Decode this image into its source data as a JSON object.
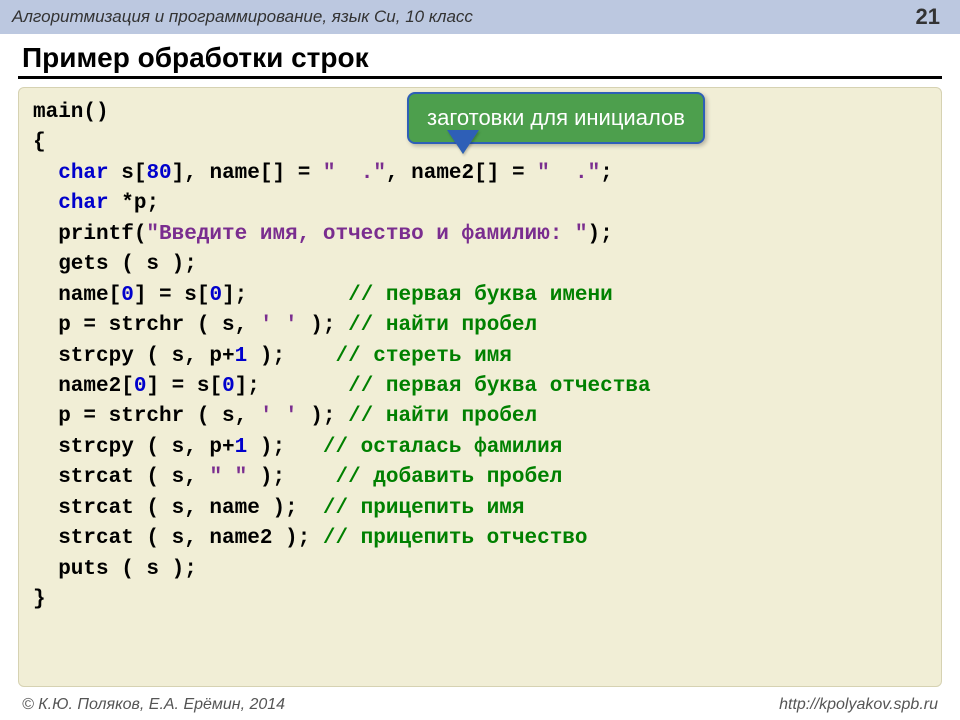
{
  "header": {
    "subject": "Алгоритмизация и программирование, язык Си, 10 класс",
    "page_number": "21"
  },
  "title": "Пример обработки строк",
  "callout": "заготовки для инициалов",
  "code": {
    "l1a": "main()",
    "l2a": "{",
    "l3_indent": "  ",
    "l3_kw": "char",
    "l3_a": " s[",
    "l3_n1": "80",
    "l3_b": "], name[] = ",
    "l3_s1": "\"  .\"",
    "l3_c": ", name2[] = ",
    "l3_s2": "\"  .\"",
    "l3_d": ";",
    "l4_kw": "char",
    "l4_a": " *p;",
    "l5_a": "  printf(",
    "l5_s": "\"Введите имя, отчество и фамилию: \"",
    "l5_b": ");",
    "l6": "  gets ( s );",
    "l7": "  name[",
    "l7_n": "0",
    "l7_b": "] = s[",
    "l7_n2": "0",
    "l7_c": "];        ",
    "l7_cmt": "// первая буква имени",
    "l8": "  p = strchr ( s, ",
    "l8_s": "' '",
    "l8_b": " ); ",
    "l8_cmt": "// найти пробел",
    "l9": "  strcpy ( s, p+",
    "l9_n": "1",
    "l9_b": " );    ",
    "l9_cmt": "// стереть имя",
    "l10": "  name2[",
    "l10_n": "0",
    "l10_b": "] = s[",
    "l10_n2": "0",
    "l10_c": "];       ",
    "l10_cmt": "// первая буква отчества",
    "l11": "  p = strchr ( s, ",
    "l11_s": "' '",
    "l11_b": " ); ",
    "l11_cmt": "// найти пробел",
    "l12": "  strcpy ( s, p+",
    "l12_n": "1",
    "l12_b": " );   ",
    "l12_cmt": "// осталась фамилия",
    "l13": "  strcat ( s, ",
    "l13_s": "\" \"",
    "l13_b": " );    ",
    "l13_cmt": "// добавить пробел",
    "l14": "  strcat ( s, name );  ",
    "l14_cmt": "// прицепить имя",
    "l15": "  strcat ( s, name2 ); ",
    "l15_cmt": "// прицепить отчество",
    "l16": "  puts ( s );",
    "l17": "}"
  },
  "footer": {
    "authors": "© К.Ю. Поляков, Е.А. Ерёмин, 2014",
    "url": "http://kpolyakov.spb.ru"
  }
}
